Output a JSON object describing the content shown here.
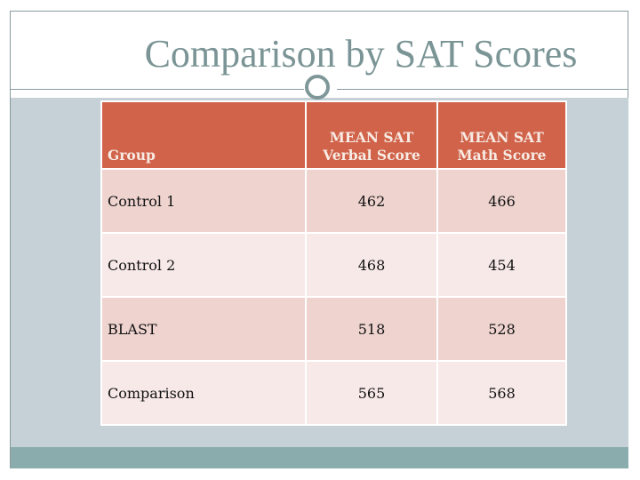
{
  "slide": {
    "title": "Comparison by SAT Scores",
    "colors": {
      "title": "#7b9495",
      "header_bg": "#d0634a",
      "header_text": "#f7ebe4",
      "row_odd": "#eed3cf",
      "row_even": "#f7e9e8",
      "panel": "#c5d1d7",
      "band": "#8aacac"
    },
    "decoration_icon": "ring-icon"
  },
  "table": {
    "headers": {
      "group": "Group",
      "verbal_line1": "MEAN SAT",
      "verbal_line2": "Verbal Score",
      "math_line1": "MEAN SAT",
      "math_line2": "Math Score"
    },
    "rows": [
      {
        "group": "Control 1",
        "verbal": "462",
        "math": "466"
      },
      {
        "group": "Control 2",
        "verbal": "468",
        "math": "454"
      },
      {
        "group": "BLAST",
        "verbal": "518",
        "math": "528"
      },
      {
        "group": "Comparison",
        "verbal": "565",
        "math": "568"
      }
    ]
  }
}
